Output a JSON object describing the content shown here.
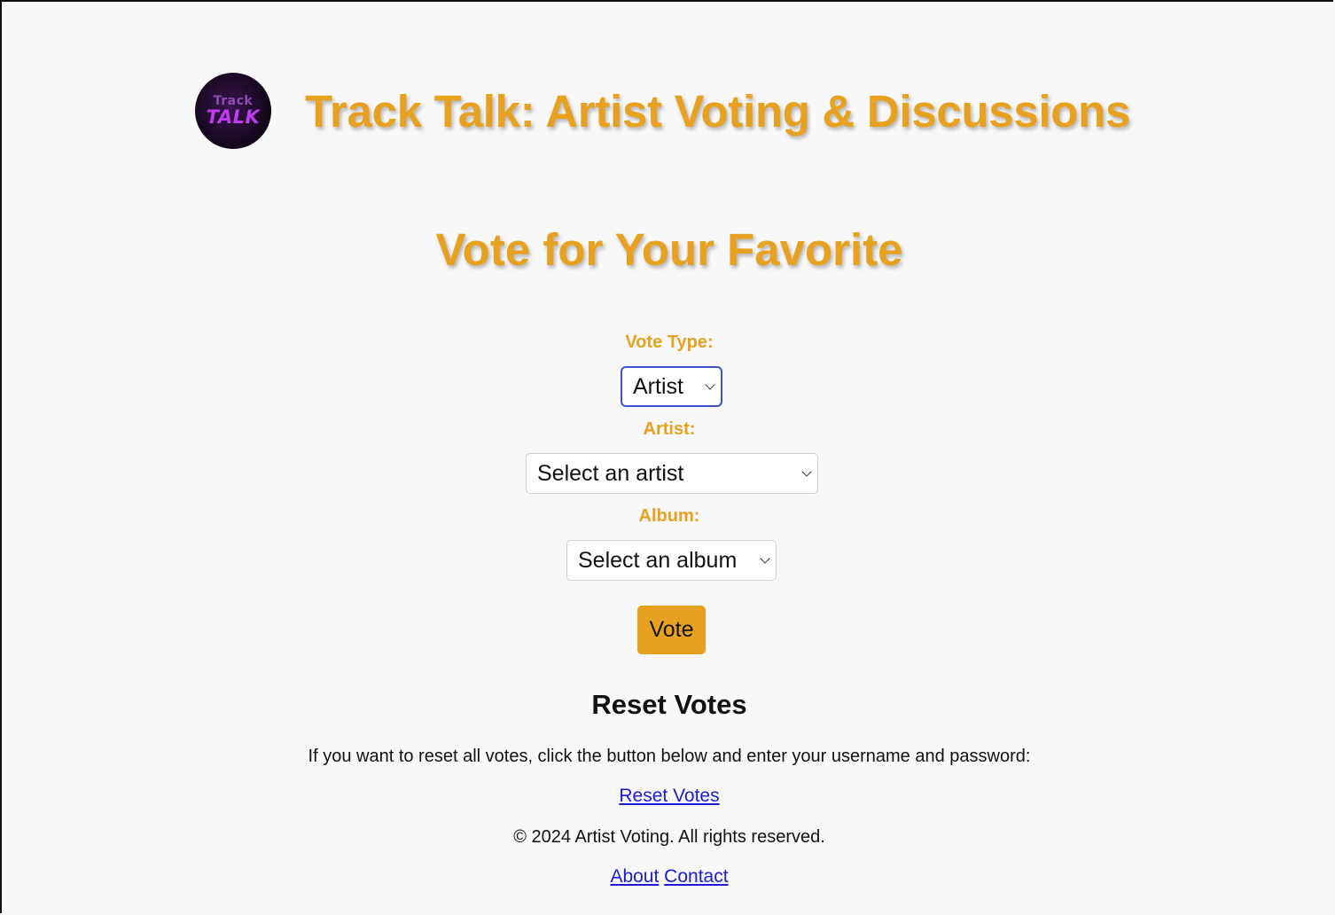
{
  "header": {
    "logo_top": "Track",
    "logo_bottom": "TALK",
    "title": "Track Talk: Artist Voting & Discussions"
  },
  "vote_section": {
    "title": "Vote for Your Favorite",
    "vote_type_label": "Vote Type:",
    "vote_type_value": "Artist",
    "artist_label": "Artist:",
    "artist_value": "Select an artist",
    "album_label": "Album:",
    "album_value": "Select an album",
    "vote_button": "Vote"
  },
  "reset_section": {
    "title": "Reset Votes",
    "description": "If you want to reset all votes, click the button below and enter your username and password:",
    "link": "Reset Votes"
  },
  "footer": {
    "copyright": "© 2024 Artist Voting. All rights reserved.",
    "links": [
      "About",
      "Contact"
    ]
  },
  "colors": {
    "accent": "#e8a01f",
    "background": "#f8f8f8",
    "link": "#1a1ad9",
    "focus": "#3b57c9"
  }
}
